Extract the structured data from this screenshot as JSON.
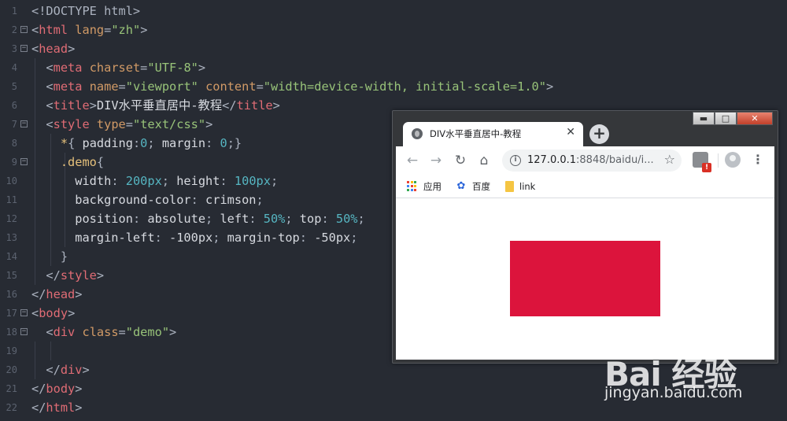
{
  "editor": {
    "line_numbers": [
      "1",
      "2",
      "3",
      "4",
      "5",
      "6",
      "7",
      "8",
      "9",
      "10",
      "11",
      "12",
      "13",
      "14",
      "15",
      "16",
      "17",
      "18",
      "19",
      "20",
      "21",
      "22"
    ],
    "lines": [
      {
        "tokens": [
          [
            "p",
            "<!DOCTYPE html>"
          ]
        ]
      },
      {
        "tokens": [
          [
            "p",
            "<"
          ],
          [
            "t",
            "html"
          ],
          [
            "a",
            " lang"
          ],
          [
            "p",
            "="
          ],
          [
            "s",
            "\"zh\""
          ],
          [
            "p",
            ">"
          ]
        ]
      },
      {
        "tokens": [
          [
            "p",
            "<"
          ],
          [
            "t",
            "head"
          ],
          [
            "p",
            ">"
          ]
        ]
      },
      {
        "tokens": [
          [
            "w",
            "  "
          ],
          [
            "p",
            "<"
          ],
          [
            "t",
            "meta"
          ],
          [
            "a",
            " charset"
          ],
          [
            "p",
            "="
          ],
          [
            "s",
            "\"UTF-8\""
          ],
          [
            "p",
            ">"
          ]
        ]
      },
      {
        "tokens": [
          [
            "w",
            "  "
          ],
          [
            "p",
            "<"
          ],
          [
            "t",
            "meta"
          ],
          [
            "a",
            " name"
          ],
          [
            "p",
            "="
          ],
          [
            "s",
            "\"viewport\""
          ],
          [
            "a",
            " content"
          ],
          [
            "p",
            "="
          ],
          [
            "s",
            "\"width=device-width, initial-scale=1.0\""
          ],
          [
            "p",
            ">"
          ]
        ]
      },
      {
        "tokens": [
          [
            "w",
            "  "
          ],
          [
            "p",
            "<"
          ],
          [
            "t",
            "title"
          ],
          [
            "p",
            ">"
          ],
          [
            "w",
            "DIV水平垂直居中-教程"
          ],
          [
            "p",
            "</"
          ],
          [
            "t",
            "title"
          ],
          [
            "p",
            ">"
          ]
        ]
      },
      {
        "tokens": [
          [
            "w",
            "  "
          ],
          [
            "p",
            "<"
          ],
          [
            "t",
            "style"
          ],
          [
            "a",
            " type"
          ],
          [
            "p",
            "="
          ],
          [
            "s",
            "\"text/css\""
          ],
          [
            "p",
            ">"
          ]
        ]
      },
      {
        "tokens": [
          [
            "w",
            "    "
          ],
          [
            "c",
            "*"
          ],
          [
            "p",
            "{ "
          ],
          [
            "w",
            "padding"
          ],
          [
            "p",
            ":"
          ],
          [
            "n",
            "0"
          ],
          [
            "p",
            "; "
          ],
          [
            "w",
            "margin"
          ],
          [
            "p",
            ": "
          ],
          [
            "n",
            "0"
          ],
          [
            "p",
            ";}"
          ]
        ]
      },
      {
        "tokens": [
          [
            "w",
            "    "
          ],
          [
            "c",
            ".demo"
          ],
          [
            "p",
            "{"
          ]
        ]
      },
      {
        "tokens": [
          [
            "w",
            "      width"
          ],
          [
            "p",
            ": "
          ],
          [
            "n",
            "200px"
          ],
          [
            "p",
            "; "
          ],
          [
            "w",
            "height"
          ],
          [
            "p",
            ": "
          ],
          [
            "n",
            "100px"
          ],
          [
            "p",
            ";"
          ]
        ]
      },
      {
        "tokens": [
          [
            "w",
            "      background-color"
          ],
          [
            "p",
            ": "
          ],
          [
            "w",
            "crimson"
          ],
          [
            "p",
            ";"
          ]
        ]
      },
      {
        "tokens": [
          [
            "w",
            "      position"
          ],
          [
            "p",
            ": "
          ],
          [
            "w",
            "absolute"
          ],
          [
            "p",
            "; "
          ],
          [
            "w",
            "left"
          ],
          [
            "p",
            ": "
          ],
          [
            "n",
            "50%"
          ],
          [
            "p",
            "; "
          ],
          [
            "w",
            "top"
          ],
          [
            "p",
            ": "
          ],
          [
            "n",
            "50%"
          ],
          [
            "p",
            ";"
          ]
        ]
      },
      {
        "tokens": [
          [
            "w",
            "      margin-left"
          ],
          [
            "p",
            ": "
          ],
          [
            "w",
            "-100px"
          ],
          [
            "p",
            "; "
          ],
          [
            "w",
            "margin-top"
          ],
          [
            "p",
            ": "
          ],
          [
            "w",
            "-50px"
          ],
          [
            "p",
            ";"
          ]
        ]
      },
      {
        "tokens": [
          [
            "w",
            "    "
          ],
          [
            "p",
            "}"
          ]
        ]
      },
      {
        "tokens": [
          [
            "w",
            "  "
          ],
          [
            "p",
            "</"
          ],
          [
            "t",
            "style"
          ],
          [
            "p",
            ">"
          ]
        ]
      },
      {
        "tokens": [
          [
            "p",
            "</"
          ],
          [
            "t",
            "head"
          ],
          [
            "p",
            ">"
          ]
        ]
      },
      {
        "tokens": [
          [
            "p",
            "<"
          ],
          [
            "t",
            "body"
          ],
          [
            "p",
            ">"
          ]
        ]
      },
      {
        "tokens": [
          [
            "w",
            "  "
          ],
          [
            "p",
            "<"
          ],
          [
            "t",
            "div"
          ],
          [
            "a",
            " class"
          ],
          [
            "p",
            "="
          ],
          [
            "s",
            "\"demo\""
          ],
          [
            "p",
            ">"
          ]
        ]
      },
      {
        "tokens": [
          [
            "w",
            ""
          ]
        ]
      },
      {
        "tokens": [
          [
            "w",
            "  "
          ],
          [
            "p",
            "</"
          ],
          [
            "t",
            "div"
          ],
          [
            "p",
            ">"
          ]
        ]
      },
      {
        "tokens": [
          [
            "p",
            "</"
          ],
          [
            "t",
            "body"
          ],
          [
            "p",
            ">"
          ]
        ]
      },
      {
        "tokens": [
          [
            "p",
            "</"
          ],
          [
            "t",
            "html"
          ],
          [
            "p",
            ">"
          ]
        ]
      }
    ]
  },
  "browser": {
    "window_controls": {
      "minimize": "▬",
      "maximize": "□",
      "close": "✕"
    },
    "tab": {
      "title": "DIV水平垂直居中-教程",
      "close": "✕"
    },
    "new_tab": "+",
    "nav": {
      "back": "←",
      "forward": "→",
      "reload": "↻",
      "home": "⌂"
    },
    "address": {
      "info": "i",
      "host": "127.0.0.1",
      "rest": ":8848/baidu/i...",
      "star": "☆"
    },
    "extension_badge": "!",
    "menu": "⋮",
    "bookmarks": [
      {
        "label": "应用",
        "icon": "apps-grid-icon"
      },
      {
        "label": "百度",
        "icon": "baidu-paw-icon"
      },
      {
        "label": "link",
        "icon": "folder-icon"
      }
    ],
    "demo_color": "#dc143c"
  },
  "watermark": {
    "logo": "Bai  经验",
    "url": "jingyan.baidu.com"
  },
  "colors": {
    "editor_bg": "#272b33",
    "tag": "#e06c75",
    "attribute": "#d19a66",
    "string": "#98c379",
    "number": "#56b6c2",
    "selector": "#e5c07b"
  }
}
